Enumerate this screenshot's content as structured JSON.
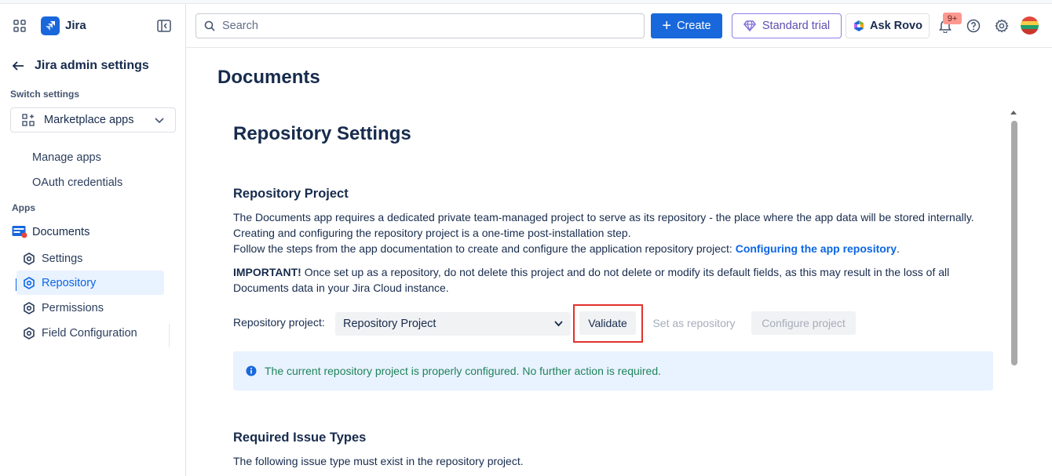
{
  "app": {
    "name": "Jira",
    "brand_color": "#1868db"
  },
  "sidebar": {
    "back_title": "Jira admin settings",
    "switch_label": "Switch settings",
    "switch_value": "Marketplace apps",
    "items": [
      "Manage apps",
      "OAuth credentials"
    ],
    "apps_label": "Apps",
    "app_name": "Documents",
    "sub_items": [
      "Settings",
      "Repository",
      "Permissions",
      "Field Configuration"
    ],
    "active_item": "Repository"
  },
  "topbar": {
    "search_placeholder": "Search",
    "create_label": "Create",
    "trial_label": "Standard trial",
    "rovo_label": "Ask Rovo",
    "notifications_badge": "9+"
  },
  "main": {
    "page_title": "Documents",
    "section_title": "Repository Settings",
    "repo_project_heading": "Repository Project",
    "desc_line1": "The Documents app requires a dedicated private team-managed project to serve as its repository - the place where the app data will be stored internally.",
    "desc_line2": "Creating and configuring the repository project is a one-time post-installation step.",
    "desc_line3_prefix": "Follow the steps from the app documentation to create and configure the application repository project: ",
    "desc_link": "Configuring the app repository",
    "desc_line3_suffix": ".",
    "important_label": "IMPORTANT!",
    "important_text": " Once set up as a repository, do not delete this project and do not delete or modify its default fields, as this may result in the loss of all Documents data in your Jira Cloud instance.",
    "repo_field_label": "Repository project:",
    "repo_field_value": "Repository Project",
    "validate_label": "Validate",
    "set_repo_label": "Set as repository",
    "configure_label": "Configure project",
    "info_message": "The current repository project is properly configured. No further action is required.",
    "issue_types_heading": "Required Issue Types",
    "issue_types_desc": "The following issue type must exist in the repository project."
  }
}
